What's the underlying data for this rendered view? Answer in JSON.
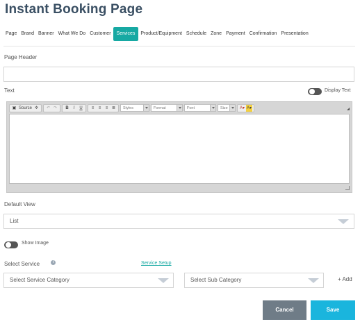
{
  "page": {
    "title": "Instant Booking Page"
  },
  "tabs": [
    {
      "label": "Page",
      "active": false
    },
    {
      "label": "Brand",
      "active": false
    },
    {
      "label": "Banner",
      "active": false
    },
    {
      "label": "What We Do",
      "active": false
    },
    {
      "label": "Customer",
      "active": false
    },
    {
      "label": "Services",
      "active": true
    },
    {
      "label": "Product/Equipment",
      "active": false
    },
    {
      "label": "Schedule",
      "active": false
    },
    {
      "label": "Zone",
      "active": false
    },
    {
      "label": "Payment",
      "active": false
    },
    {
      "label": "Confirmation",
      "active": false
    },
    {
      "label": "Presentation",
      "active": false
    }
  ],
  "form": {
    "page_header_label": "Page Header",
    "page_header_value": "",
    "text_label": "Text",
    "display_text_label": "Display Text",
    "editor": {
      "source_label": "Source",
      "styles_placeholder": "Styles",
      "format_placeholder": "Format",
      "font_placeholder": "Font",
      "size_placeholder": "Size",
      "bold": "B",
      "italic": "I",
      "underline": "U"
    },
    "default_view_label": "Default View",
    "default_view_value": "List",
    "show_image_label": "Show Image",
    "select_service_label": "Select Service",
    "service_setup_link": "Service Setup",
    "service_category_placeholder": "Select Service Category",
    "sub_category_placeholder": "Select Sub Category",
    "add_label": "+ Add"
  },
  "actions": {
    "cancel_label": "Cancel",
    "save_label": "Save"
  },
  "colors": {
    "accent": "#17a9a3",
    "save": "#1ab5dd",
    "cancel": "#6f7c87",
    "title": "#3a4f63"
  }
}
